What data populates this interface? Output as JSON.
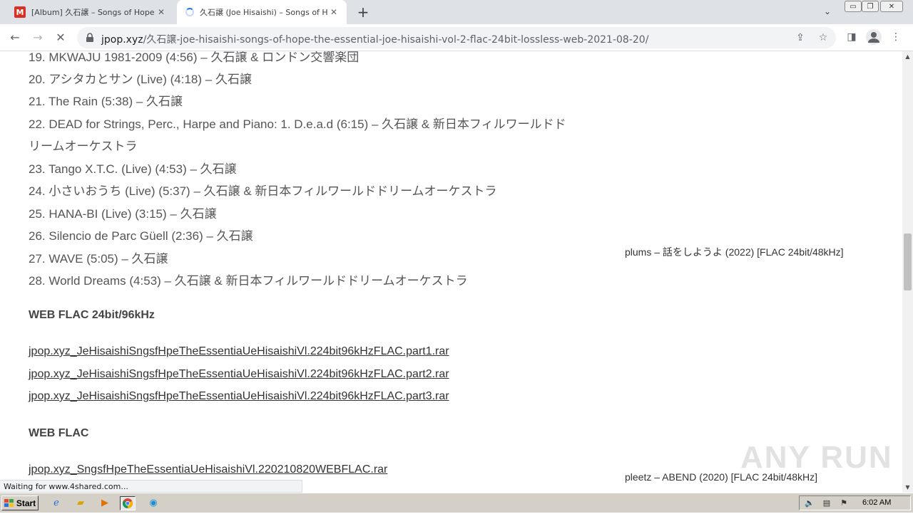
{
  "browser": {
    "tabs": [
      {
        "title": "[Album] 久石譲 – Songs of Hope: Th",
        "favicon": "M",
        "active": false
      },
      {
        "title": "久石譲 (Joe Hisaishi) – Songs of Hop",
        "favicon": "loading-spinner",
        "active": true
      }
    ],
    "new_tab_symbol": "+",
    "url_host": "jpop.xyz",
    "url_path": "/久石譲-joe-hisaishi-songs-of-hope-the-essential-joe-hisaishi-vol-2-flac-24bit-lossless-web-2021-08-20/",
    "status_text": "Waiting for www.4shared.com..."
  },
  "tracklist": [
    {
      "text": "19. MKWAJU 1981-2009 (4:56) – 久石譲 & ロンドン交響楽団"
    },
    {
      "text": "20. アシタカとサン (Live) (4:18) – 久石譲"
    },
    {
      "text": "21. The Rain (5:38) – 久石譲"
    },
    {
      "text": "22. DEAD for Strings, Perc., Harpe and Piano: 1. D.e.a.d (6:15) – 久石譲 & 新日本フィルワールドド"
    },
    {
      "text": "リームオーケストラ"
    },
    {
      "text": "23. Tango X.T.C. (Live) (4:53) – 久石譲"
    },
    {
      "text": "24. 小さいおうち (Live) (5:37) – 久石譲 & 新日本フィルワールドドリームオーケストラ"
    },
    {
      "text": "25. HANA-BI (Live) (3:15) – 久石譲"
    },
    {
      "text": "26. Silencio de Parc Güell (2:36) – 久石譲"
    },
    {
      "text": "27. WAVE (5:05) – 久石譲"
    },
    {
      "text": "28. World Dreams (4:53) – 久石譲 & 新日本フィルワールドドリームオーケストラ"
    }
  ],
  "downloads": {
    "section1_title": "WEB FLAC 24bit/96kHz",
    "section1_links": [
      "jpop.xyz_JeHisaishiSngsfHpeTheEssentiaUeHisaishiVl.224bit96kHzFLAC.part1.rar",
      "jpop.xyz_JeHisaishiSngsfHpeTheEssentiaUeHisaishiVl.224bit96kHzFLAC.part2.rar",
      "jpop.xyz_JeHisaishiSngsfHpeTheEssentiaUeHisaishiVl.224bit96kHzFLAC.part3.rar"
    ],
    "section2_title": "WEB FLAC",
    "section2_links": [
      "jpop.xyz_SngsfHpeTheEssentiaUeHisaishiVl.220210820WEBFLAC.rar"
    ]
  },
  "sidebar": {
    "posts": [
      "plums – 話をしようよ (2022) [FLAC 24bit/48kHz]",
      "pleetz – ABEND (2020) [FLAC 24bit/48kHz]"
    ]
  },
  "watermark": "ANY RUN",
  "taskbar": {
    "start_label": "Start",
    "clock": "6:02 AM"
  },
  "colors": {
    "accent": "#1a73e8",
    "tab_strip": "#dee1e6",
    "taskbar": "#d4d0c8"
  }
}
